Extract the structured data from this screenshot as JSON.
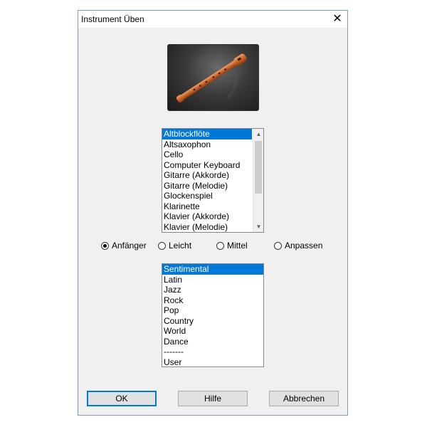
{
  "dialog": {
    "title": "Instrument Üben",
    "close_icon": "close-icon"
  },
  "preview": {
    "image": "recorder-flute-image"
  },
  "instruments": {
    "selected_index": 0,
    "items": [
      "Altblockflöte",
      "Altsaxophon",
      "Cello",
      "Computer Keyboard",
      "Gitarre (Akkorde)",
      "Gitarre (Melodie)",
      "Glockenspiel",
      "Klarinette",
      "Klavier (Akkorde)",
      "Klavier (Melodie)"
    ]
  },
  "difficulty": {
    "selected_index": 0,
    "options": [
      "Anfänger",
      "Leicht",
      "Mittel",
      "Anpassen"
    ]
  },
  "styles": {
    "selected_index": 0,
    "items": [
      "Sentimental",
      "Latin",
      "Jazz",
      "Rock",
      "Pop",
      "Country",
      "World",
      "Dance",
      "-------",
      "User"
    ]
  },
  "buttons": {
    "ok": "OK",
    "help": "Hilfe",
    "cancel": "Abbrechen"
  },
  "colors": {
    "selection": "#0078d7",
    "dialog_bg": "#f0f0f0",
    "border": "#7a9cc6"
  }
}
